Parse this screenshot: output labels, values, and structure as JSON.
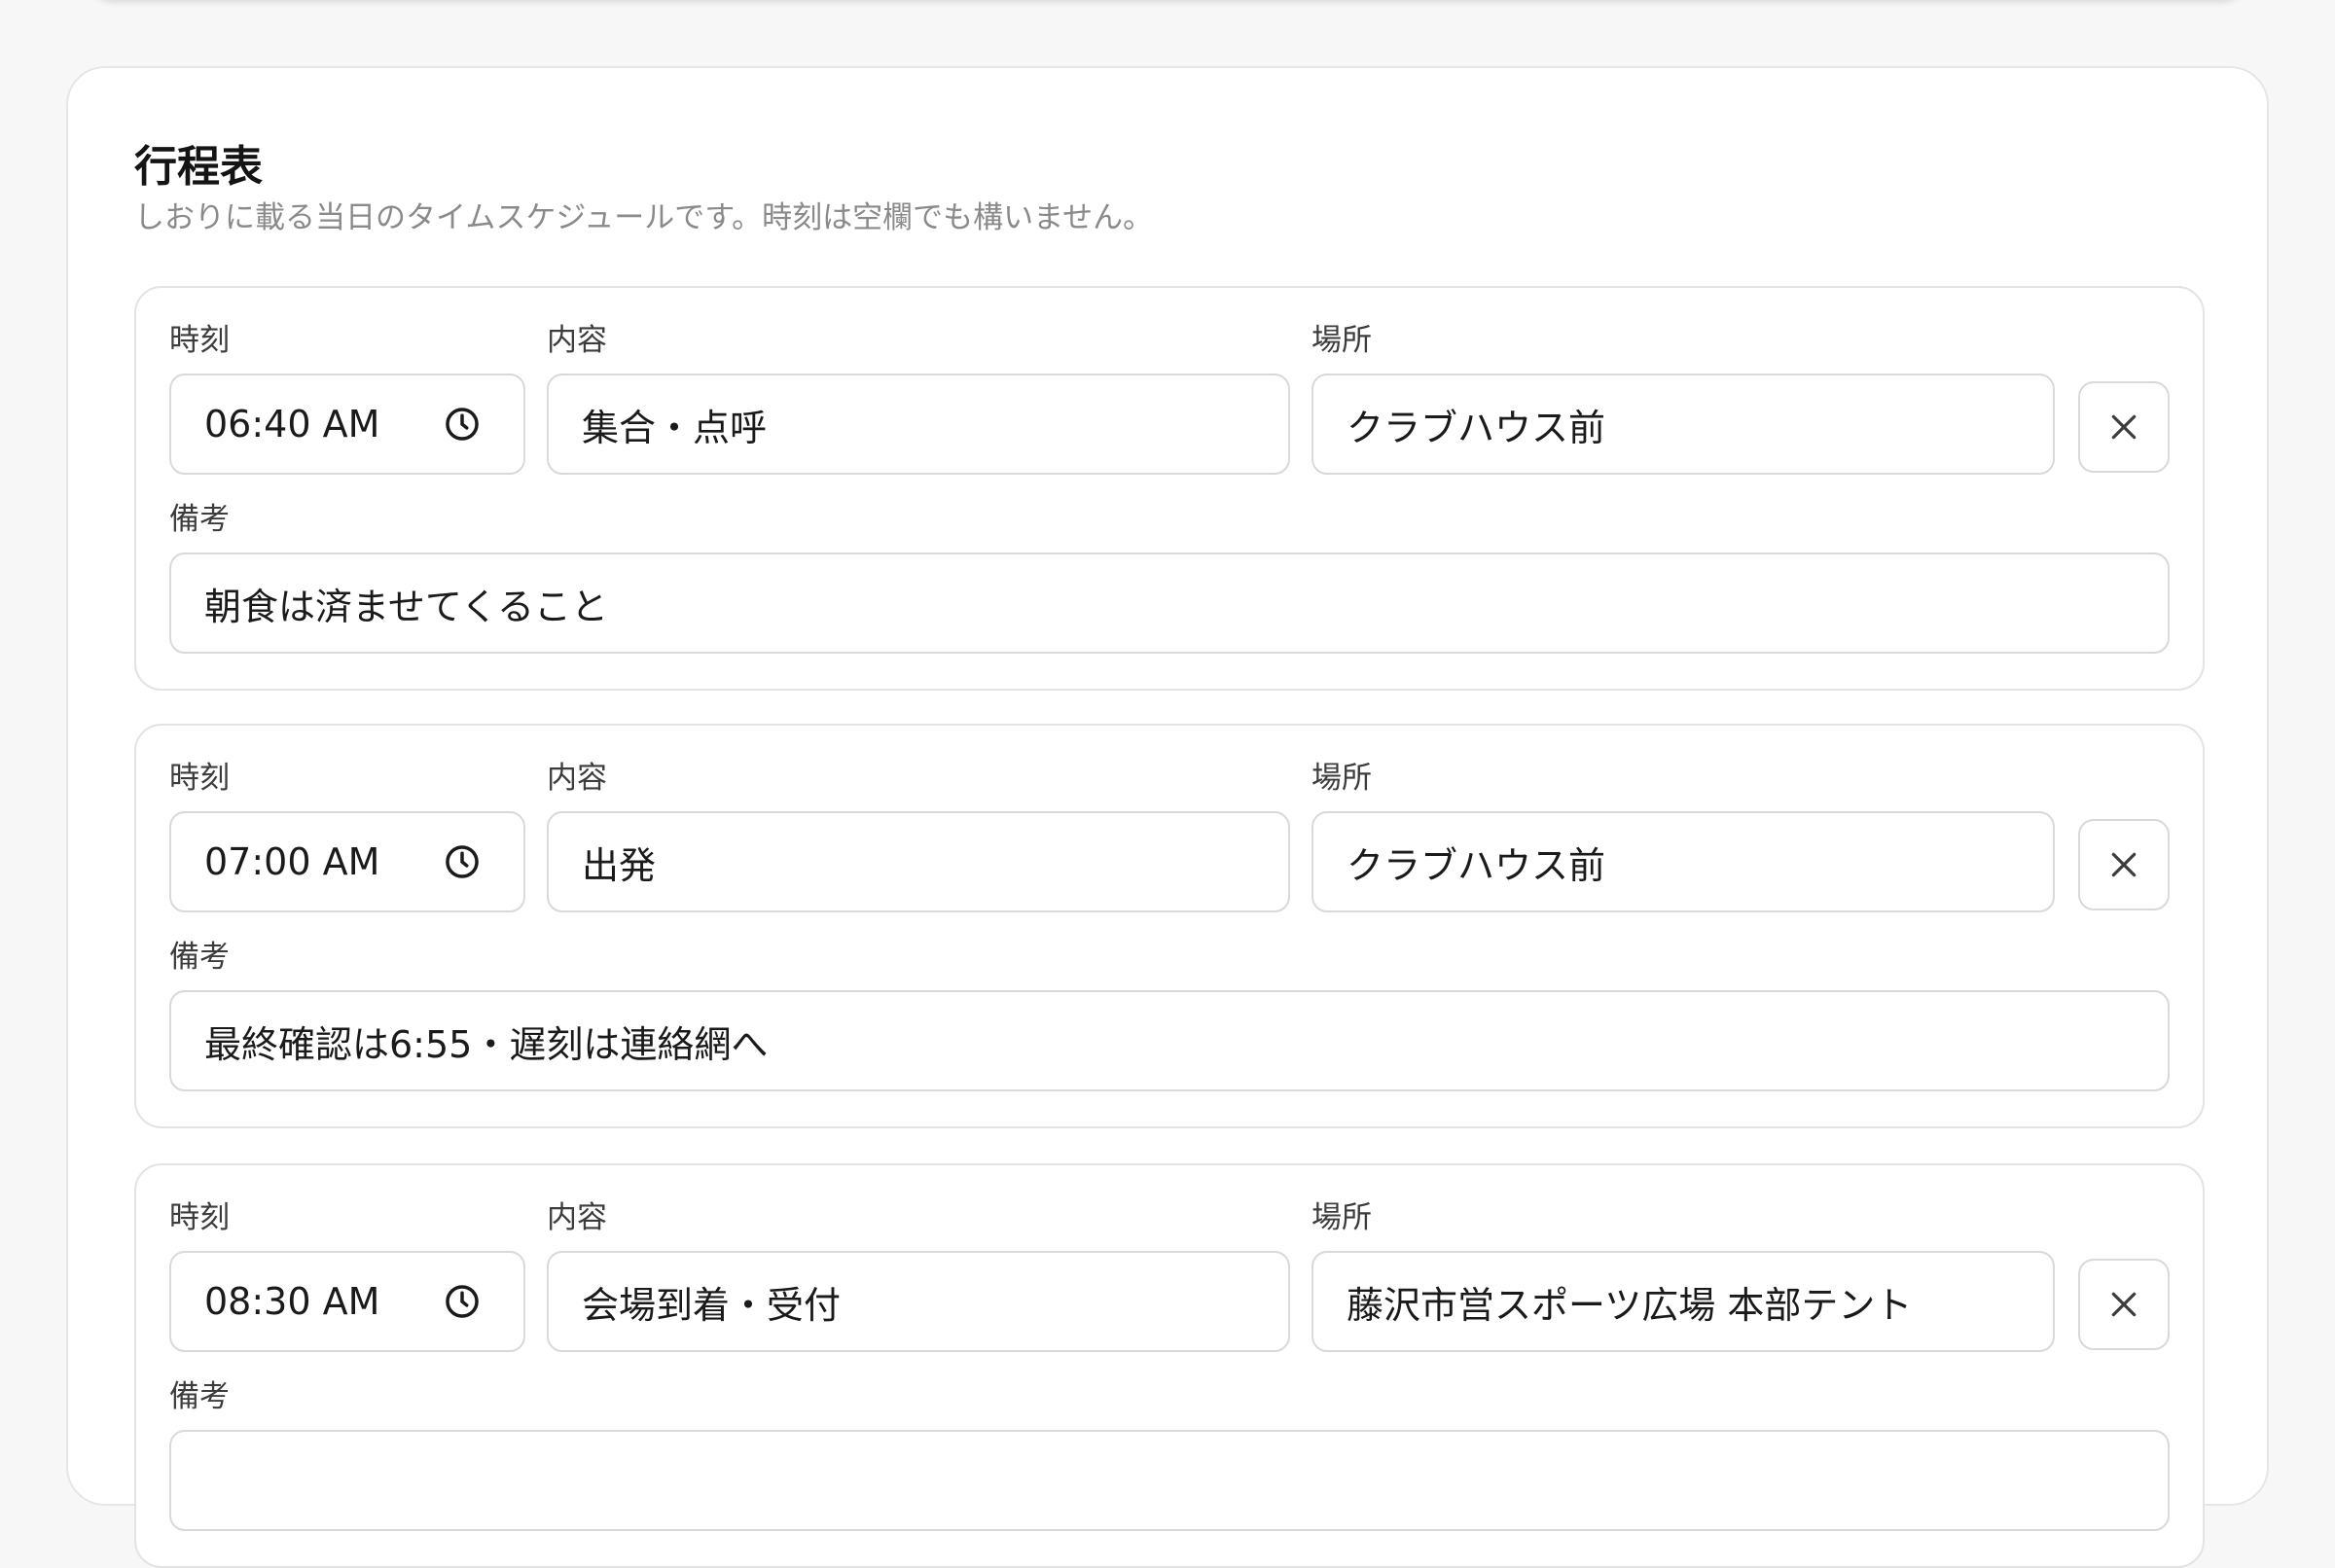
{
  "schedule": {
    "title": "行程表",
    "description": "しおりに載る当日のタイムスケジュールです。時刻は空欄でも構いません。",
    "labels": {
      "time": "時刻",
      "content": "内容",
      "place": "場所",
      "note": "備考"
    },
    "entries": [
      {
        "time": "06:40 AM",
        "content": "集合・点呼",
        "place": "クラブハウス前",
        "note": "朝食は済ませてくること"
      },
      {
        "time": "07:00 AM",
        "content": "出発",
        "place": "クラブハウス前",
        "note": "最終確認は6:55・遅刻は連絡網へ"
      },
      {
        "time": "08:30 AM",
        "content": "会場到着・受付",
        "place": "藤沢市営スポーツ広場 本部テント",
        "note": ""
      }
    ]
  },
  "icons": {
    "time_picker": "clock-icon",
    "remove": "close-icon"
  },
  "colors": {
    "border": "#d9d9d9",
    "muted_text": "#8a8a8a",
    "background": "#f7f7f7"
  }
}
